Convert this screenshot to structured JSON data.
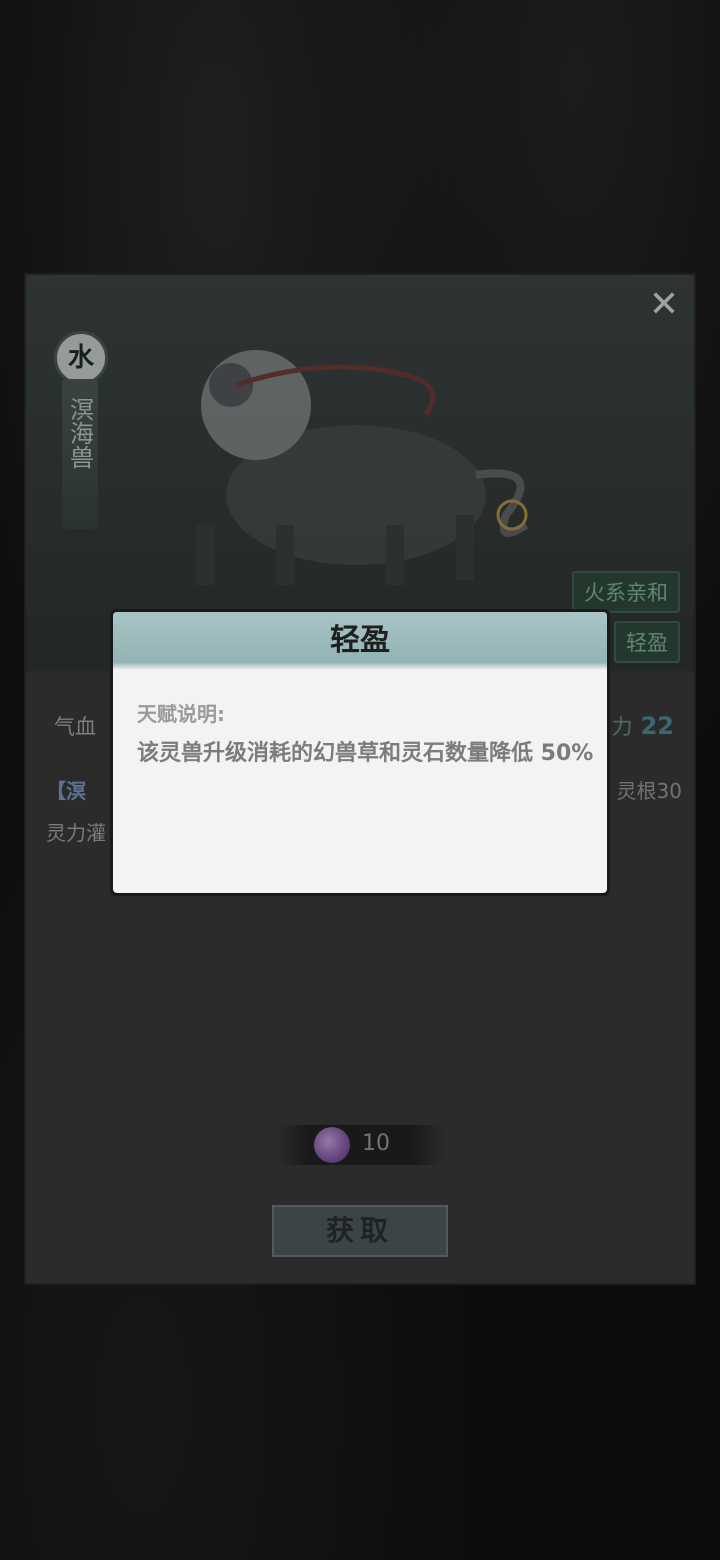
{
  "beast": {
    "element": "水",
    "name": "溟海兽",
    "tags": [
      "火系亲和",
      "轻盈"
    ]
  },
  "stats": {
    "left_label": "气血",
    "right_label": "力",
    "right_value": "22"
  },
  "skill": {
    "line1_left": "【溟",
    "line1_right": "灵根30",
    "line2_left": "灵力灌"
  },
  "cost": {
    "icon": "spirit-gem-icon",
    "amount": "10"
  },
  "acquire_label": "获取",
  "modal": {
    "title": "轻盈",
    "label": "天赋说明:",
    "text": "该灵兽升级消耗的幻兽草和灵石数量降低 50%"
  }
}
